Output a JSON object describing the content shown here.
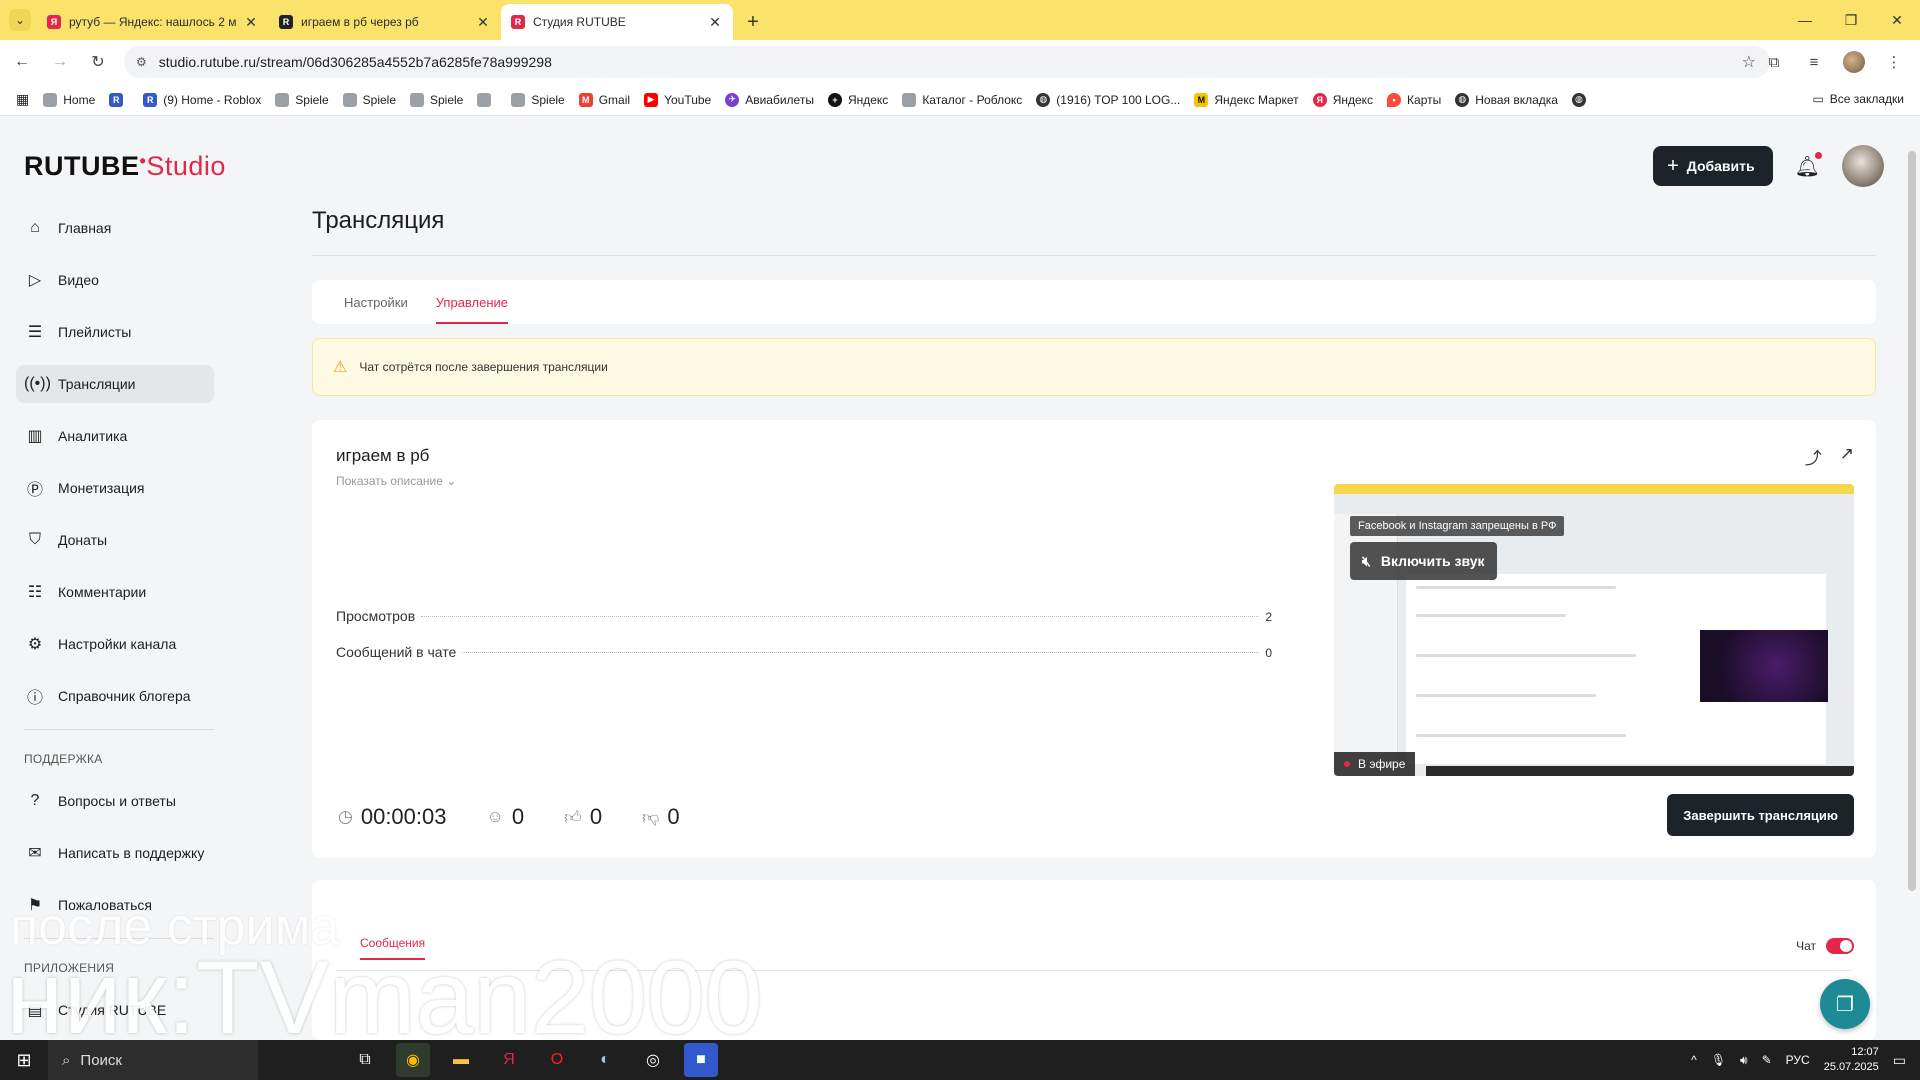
{
  "browser": {
    "tabs": [
      {
        "title": "рутуб — Яндекс: нашлось 2 м",
        "favicon": "yandex-icon",
        "color": "#e3274a"
      },
      {
        "title": "играем в рб через рб",
        "favicon": "roblox-icon",
        "color": "#222222"
      },
      {
        "title": "Студия RUTUBE",
        "favicon": "rutube-icon",
        "color": "#e3274a"
      }
    ],
    "url": "studio.rutube.ru/stream/06d306285a4552b7a6285fe78a999298",
    "bookmarks": [
      "Home",
      "(9) Home - Roblox",
      "Spiele",
      "Spiele",
      "Spiele",
      "Spiele",
      "Gmail",
      "YouTube",
      "Авиабилеты",
      "Яндекс",
      "Каталог - Роблокс",
      "(1916) TOP 100 LOG...",
      "Яндекс Маркет",
      "Яндекс",
      "Карты",
      "Новая вкладка"
    ],
    "all_bookmarks": "Все закладки"
  },
  "header": {
    "logo_main": "RUTUBE",
    "logo_accent": "Studio",
    "add_label": "Добавить"
  },
  "sidebar": {
    "items": [
      {
        "label": "Главная",
        "icon": "home-icon"
      },
      {
        "label": "Видео",
        "icon": "video-icon"
      },
      {
        "label": "Плейлисты",
        "icon": "playlist-icon"
      },
      {
        "label": "Трансляции",
        "icon": "broadcast-icon"
      },
      {
        "label": "Аналитика",
        "icon": "analytics-icon"
      },
      {
        "label": "Монетизация",
        "icon": "money-icon"
      },
      {
        "label": "Донаты",
        "icon": "donate-icon"
      },
      {
        "label": "Комментарии",
        "icon": "comments-icon"
      },
      {
        "label": "Настройки канала",
        "icon": "settings-icon"
      },
      {
        "label": "Справочник блогера",
        "icon": "info-icon"
      }
    ],
    "support_title": "ПОДДЕРЖКА",
    "support_items": [
      {
        "label": "Вопросы и ответы",
        "icon": "question-icon"
      },
      {
        "label": "Написать в поддержку",
        "icon": "mail-icon"
      },
      {
        "label": "Пожаловаться",
        "icon": "flag-icon"
      }
    ],
    "apps_title": "ПРИЛОЖЕНИЯ",
    "apps_items": [
      {
        "label": "Студия RUTUBE",
        "icon": "app-icon"
      }
    ]
  },
  "main": {
    "title": "Трансляция",
    "tabs": [
      "Настройки",
      "Управление"
    ],
    "warning": "Чат сотрётся после завершения трансляции",
    "stream": {
      "name": "играем в рб",
      "show_description": "Показать описание",
      "views_label": "Просмотров",
      "views_value": "2",
      "messages_label": "Сообщений в чате",
      "messages_value": "0",
      "duration": "00:00:03",
      "viewers": "0",
      "likes": "0",
      "dislikes": "0",
      "end_button": "Завершить трансляцию"
    },
    "preview": {
      "banner": "Facebook и Instagram запрещены в РФ",
      "unmute": "Включить звук",
      "live": "В эфире"
    },
    "chat": {
      "tab": "Сообщения",
      "toggle_label": "Чат"
    }
  },
  "overlay": {
    "line1": "после стрима",
    "line2": "ник:TVman2000"
  },
  "taskbar": {
    "search": "Поиск",
    "lang": "РУС",
    "time": "12:07",
    "date": "25.07.2025"
  }
}
